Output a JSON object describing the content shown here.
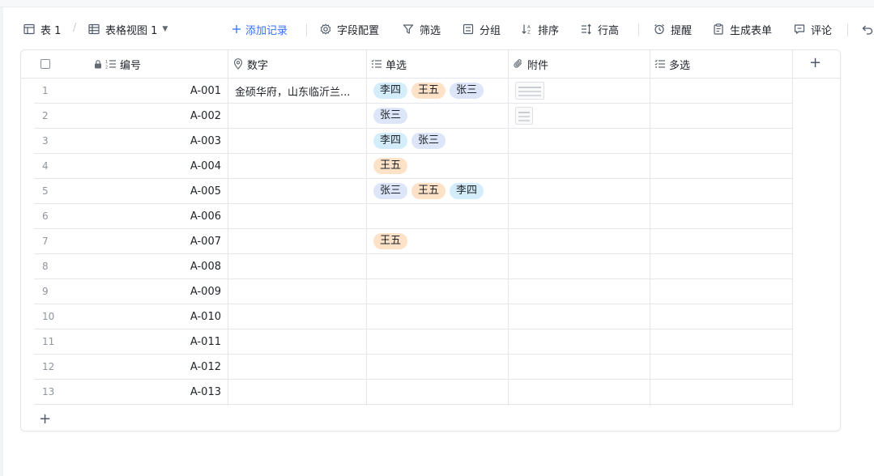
{
  "toolbar": {
    "table_tab": "表 1",
    "slash": "/",
    "view_tab": "表格视图 1",
    "add_record": "添加记录",
    "field_config": "字段配置",
    "filter": "筛选",
    "group": "分组",
    "sort": "排序",
    "row_height": "行高",
    "reminder": "提醒",
    "generate_form": "生成表单",
    "comment": "评论"
  },
  "columns": [
    "编号",
    "数字",
    "单选",
    "附件",
    "多选"
  ],
  "tag_colors": {
    "李四": {
      "bg": "#d4edfb",
      "fg": "#1f2329"
    },
    "王五": {
      "bg": "#fde2c7",
      "fg": "#1f2329"
    },
    "张三": {
      "bg": "#dde6f8",
      "fg": "#1f2329"
    }
  },
  "rows": [
    {
      "num": "1",
      "id": "A-001",
      "address": "金硕华府，山东临沂兰...",
      "tags": [
        "李四",
        "王五",
        "张三"
      ],
      "attachments": [
        "wide"
      ]
    },
    {
      "num": "2",
      "id": "A-002",
      "address": "",
      "tags": [
        "张三"
      ],
      "attachments": [
        "narrow"
      ]
    },
    {
      "num": "3",
      "id": "A-003",
      "address": "",
      "tags": [
        "李四",
        "张三"
      ],
      "attachments": []
    },
    {
      "num": "4",
      "id": "A-004",
      "address": "",
      "tags": [
        "王五"
      ],
      "attachments": []
    },
    {
      "num": "5",
      "id": "A-005",
      "address": "",
      "tags": [
        "张三",
        "王五",
        "李四"
      ],
      "attachments": []
    },
    {
      "num": "6",
      "id": "A-006",
      "address": "",
      "tags": [],
      "attachments": []
    },
    {
      "num": "7",
      "id": "A-007",
      "address": "",
      "tags": [
        "王五"
      ],
      "attachments": []
    },
    {
      "num": "8",
      "id": "A-008",
      "address": "",
      "tags": [],
      "attachments": []
    },
    {
      "num": "9",
      "id": "A-009",
      "address": "",
      "tags": [],
      "attachments": []
    },
    {
      "num": "10",
      "id": "A-010",
      "address": "",
      "tags": [],
      "attachments": []
    },
    {
      "num": "11",
      "id": "A-011",
      "address": "",
      "tags": [],
      "attachments": []
    },
    {
      "num": "12",
      "id": "A-012",
      "address": "",
      "tags": [],
      "attachments": []
    },
    {
      "num": "13",
      "id": "A-013",
      "address": "",
      "tags": [],
      "attachments": []
    }
  ]
}
